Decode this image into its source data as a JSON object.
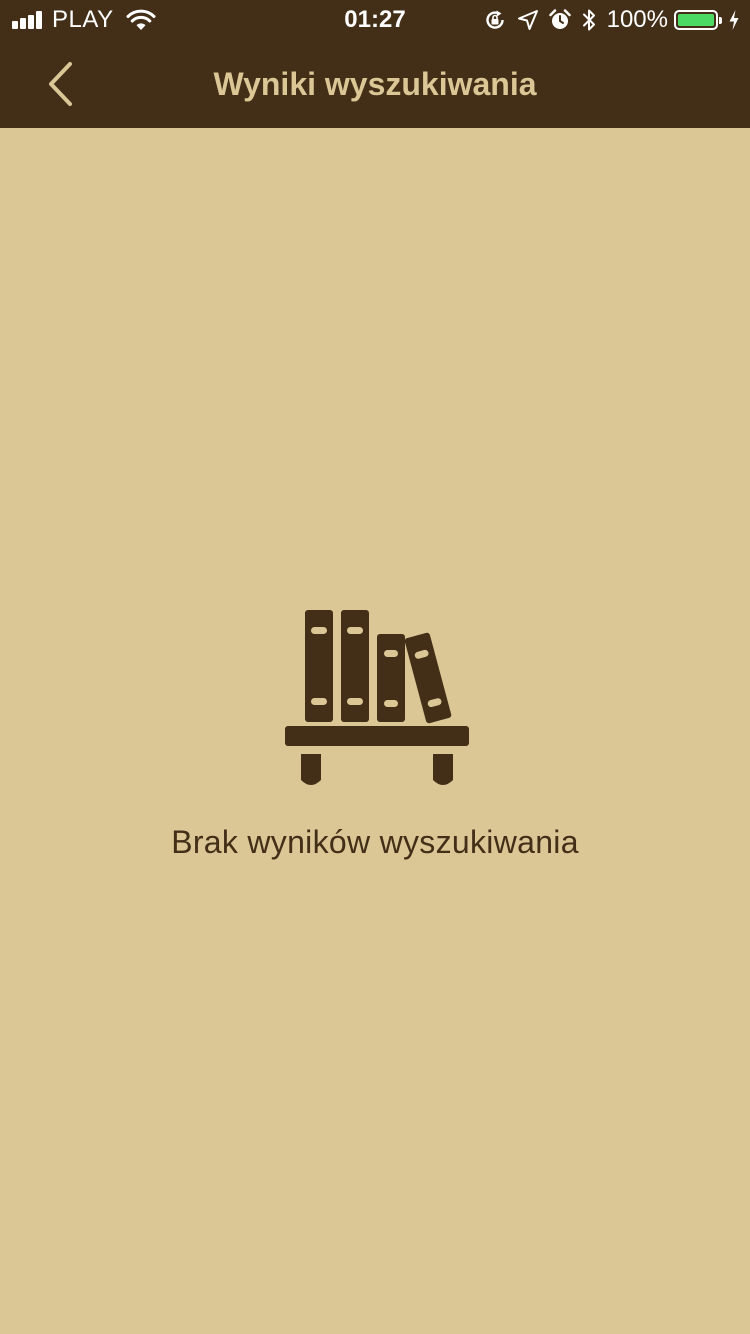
{
  "status_bar": {
    "carrier": "PLAY",
    "time": "01:27",
    "battery_percent": "100%",
    "icons": [
      "signal-icon",
      "wifi-icon",
      "orientation-lock-icon",
      "location-icon",
      "alarm-icon",
      "bluetooth-icon",
      "battery-icon",
      "charging-icon"
    ]
  },
  "nav": {
    "title": "Wyniki wyszukiwania",
    "back_icon": "chevron-left-icon"
  },
  "empty_state": {
    "icon": "bookshelf-icon",
    "message": "Brak wyników wyszukiwania"
  },
  "colors": {
    "header_background": "#432F18",
    "page_background": "#DAC795",
    "title_color": "#DAC795",
    "text_color": "#432F18",
    "battery_fill": "#4CD964"
  }
}
